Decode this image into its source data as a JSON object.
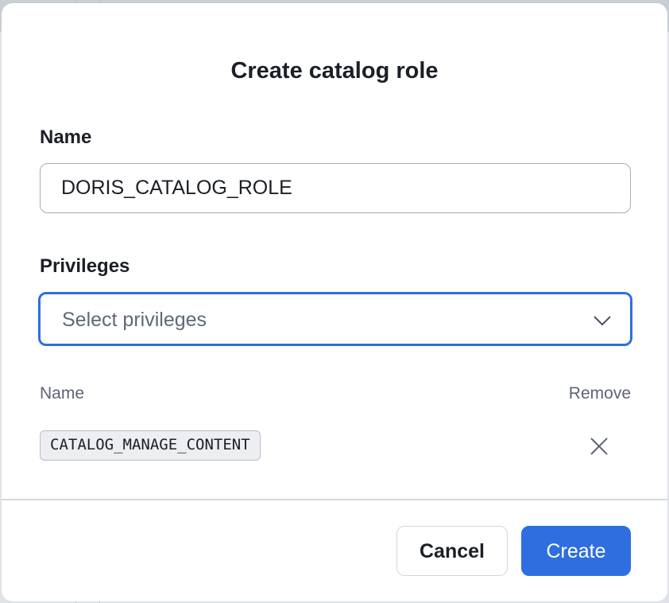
{
  "dialog": {
    "title": "Create catalog role",
    "name_field": {
      "label": "Name",
      "value": "DORIS_CATALOG_ROLE",
      "placeholder": ""
    },
    "privileges_field": {
      "label": "Privileges",
      "placeholder": "Select privileges",
      "icon": "chevron-down-icon"
    },
    "privileges_table": {
      "columns": [
        "Name",
        "Remove"
      ],
      "rows": [
        {
          "name": "CATALOG_MANAGE_CONTENT",
          "remove_icon": "close-icon"
        }
      ]
    },
    "footer": {
      "cancel_label": "Cancel",
      "create_label": "Create"
    }
  },
  "colors": {
    "accent": "#2f6ee0",
    "text": "#1b1f27",
    "muted_text": "#5c6475",
    "tag_background": "#eceef1",
    "border": "#a6adb9"
  }
}
